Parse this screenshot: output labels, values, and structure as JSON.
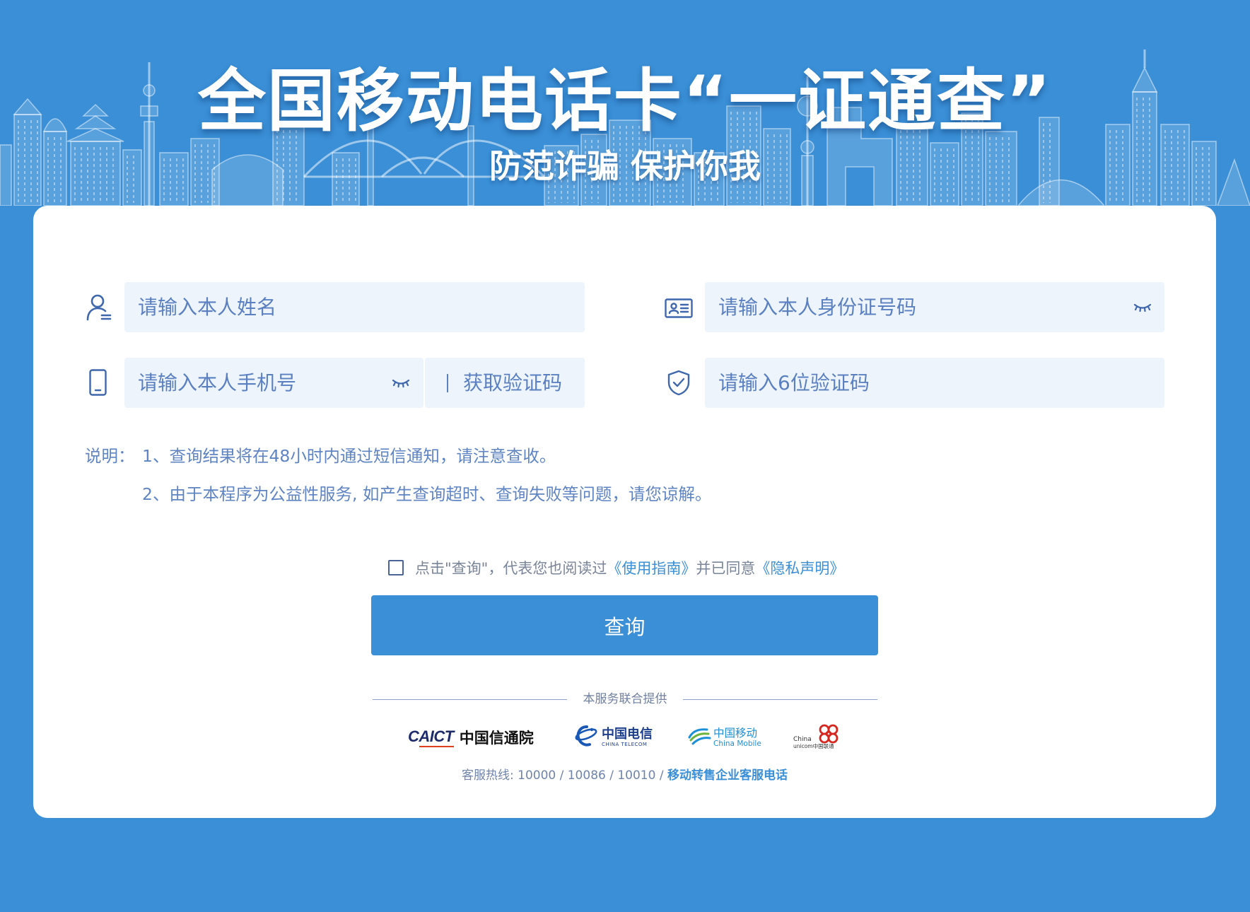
{
  "banner": {
    "title": "全国移动电话卡“一证通查”",
    "subtitle": "防范诈骗 保护你我"
  },
  "form": {
    "name": {
      "placeholder": "请输入本人姓名",
      "icon": "user-icon"
    },
    "id_number": {
      "placeholder": "请输入本人身份证号码",
      "icon": "id-card-icon",
      "visibility_icon": "eye-closed-icon"
    },
    "phone": {
      "placeholder": "请输入本人手机号",
      "icon": "phone-icon",
      "visibility_icon": "eye-closed-icon"
    },
    "get_code": {
      "label": "获取验证码"
    },
    "code": {
      "placeholder": "请输入6位验证码",
      "icon": "shield-check-icon"
    }
  },
  "notes": {
    "label": "说明：",
    "items": [
      "1、查询结果将在48小时内通过短信通知，请注意查收。",
      "2、由于本程序为公益性服务, 如产生查询超时、查询失败等问题，请您谅解。"
    ]
  },
  "agreement": {
    "checked": false,
    "prefix": "点击\"查询\"，代表您也阅读过 ",
    "guide_link": "《使用指南》",
    "middle": "并已同意 ",
    "privacy_link": "《隐私声明》"
  },
  "submit": {
    "label": "查询"
  },
  "providers": {
    "label": "本服务联合提供",
    "caict": {
      "latin": "CAICT",
      "name": "中国信通院"
    },
    "telecom": {
      "name": "中国电信",
      "latin": "CHINA TELECOM"
    },
    "mobile": {
      "name": "中国移动",
      "latin": "China Mobile"
    },
    "unicom": {
      "latin_top": "China",
      "latin_bottom": "unicom中国联通"
    }
  },
  "footer": {
    "hotline": "客服热线: 10000 / 10086 / 10010 / ",
    "link": "移动转售企业客服电话"
  },
  "colors": {
    "background": "#3a8fd6",
    "accent": "#3a8fd6",
    "icon": "#3f67ad",
    "input_background": "#eef4fc",
    "placeholder": "#5a80c2",
    "card": "#ffffff"
  }
}
